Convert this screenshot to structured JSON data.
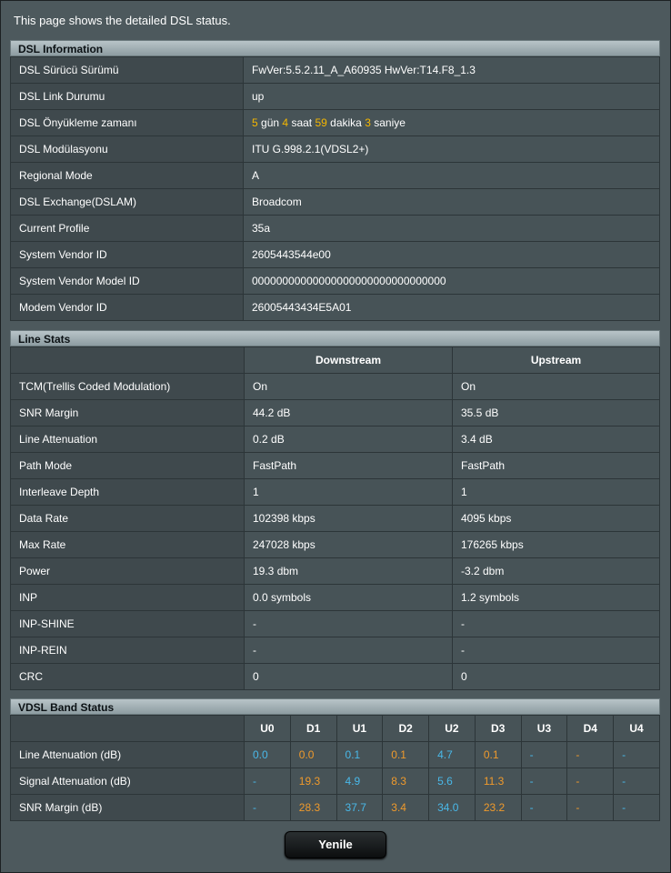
{
  "intro": "This page shows the detailed DSL status.",
  "dsl_info": {
    "title": "DSL Information",
    "rows": [
      {
        "label": "DSL Sürücü Sürümü",
        "value": "FwVer:5.5.2.11_A_A60935 HwVer:T14.F8_1.3"
      },
      {
        "label": "DSL Link Durumu",
        "value": "up"
      },
      {
        "label": "DSL Önyükleme zamanı",
        "uptime": {
          "days": "5",
          "days_unit": "gün",
          "hours": "4",
          "hours_unit": "saat",
          "minutes": "59",
          "minutes_unit": "dakika",
          "seconds": "3",
          "seconds_unit": "saniye"
        }
      },
      {
        "label": "DSL Modülasyonu",
        "value": "ITU G.998.2.1(VDSL2+)"
      },
      {
        "label": "Regional Mode",
        "value": "A"
      },
      {
        "label": "DSL Exchange(DSLAM)",
        "value": "Broadcom"
      },
      {
        "label": "Current Profile",
        "value": "35a"
      },
      {
        "label": "System Vendor ID",
        "value": "2605443544e00"
      },
      {
        "label": "System Vendor Model ID",
        "value": "00000000000000000000000000000000"
      },
      {
        "label": "Modem Vendor ID",
        "value": "26005443434E5A01"
      }
    ]
  },
  "line_stats": {
    "title": "Line Stats",
    "col_down": "Downstream",
    "col_up": "Upstream",
    "rows": [
      {
        "label": "TCM(Trellis Coded Modulation)",
        "down": "On",
        "up": "On"
      },
      {
        "label": "SNR Margin",
        "down": "44.2 dB",
        "up": "35.5 dB"
      },
      {
        "label": "Line Attenuation",
        "down": "0.2 dB",
        "up": "3.4 dB"
      },
      {
        "label": "Path Mode",
        "down": "FastPath",
        "up": "FastPath"
      },
      {
        "label": "Interleave Depth",
        "down": "1",
        "up": "1"
      },
      {
        "label": "Data Rate",
        "down": "102398 kbps",
        "up": "4095 kbps"
      },
      {
        "label": "Max Rate",
        "down": "247028 kbps",
        "up": "176265 kbps"
      },
      {
        "label": "Power",
        "down": "19.3 dbm",
        "up": "-3.2 dbm"
      },
      {
        "label": "INP",
        "down": "0.0 symbols",
        "up": "1.2 symbols"
      },
      {
        "label": "INP-SHINE",
        "down": "-",
        "up": "-"
      },
      {
        "label": "INP-REIN",
        "down": "-",
        "up": "-"
      },
      {
        "label": "CRC",
        "down": "0",
        "up": "0"
      }
    ]
  },
  "vdsl_band": {
    "title": "VDSL Band Status",
    "bands": [
      "U0",
      "D1",
      "U1",
      "D2",
      "U2",
      "D3",
      "U3",
      "D4",
      "U4"
    ],
    "colors": {
      "upstream": "#49b8e8",
      "downstream": "#ef9a2c"
    },
    "rows": [
      {
        "label": "Line Attenuation (dB)",
        "values": [
          "0.0",
          "0.0",
          "0.1",
          "0.1",
          "4.7",
          "0.1",
          "-",
          "-",
          "-"
        ]
      },
      {
        "label": "Signal Attenuation (dB)",
        "values": [
          "-",
          "19.3",
          "4.9",
          "8.3",
          "5.6",
          "11.3",
          "-",
          "-",
          "-"
        ]
      },
      {
        "label": "SNR Margin (dB)",
        "values": [
          "-",
          "28.3",
          "37.7",
          "3.4",
          "34.0",
          "23.2",
          "-",
          "-",
          "-"
        ]
      }
    ]
  },
  "refresh_button": "Yenile",
  "theme": {
    "background": "#4d595d",
    "highlight": "#f5b700"
  }
}
